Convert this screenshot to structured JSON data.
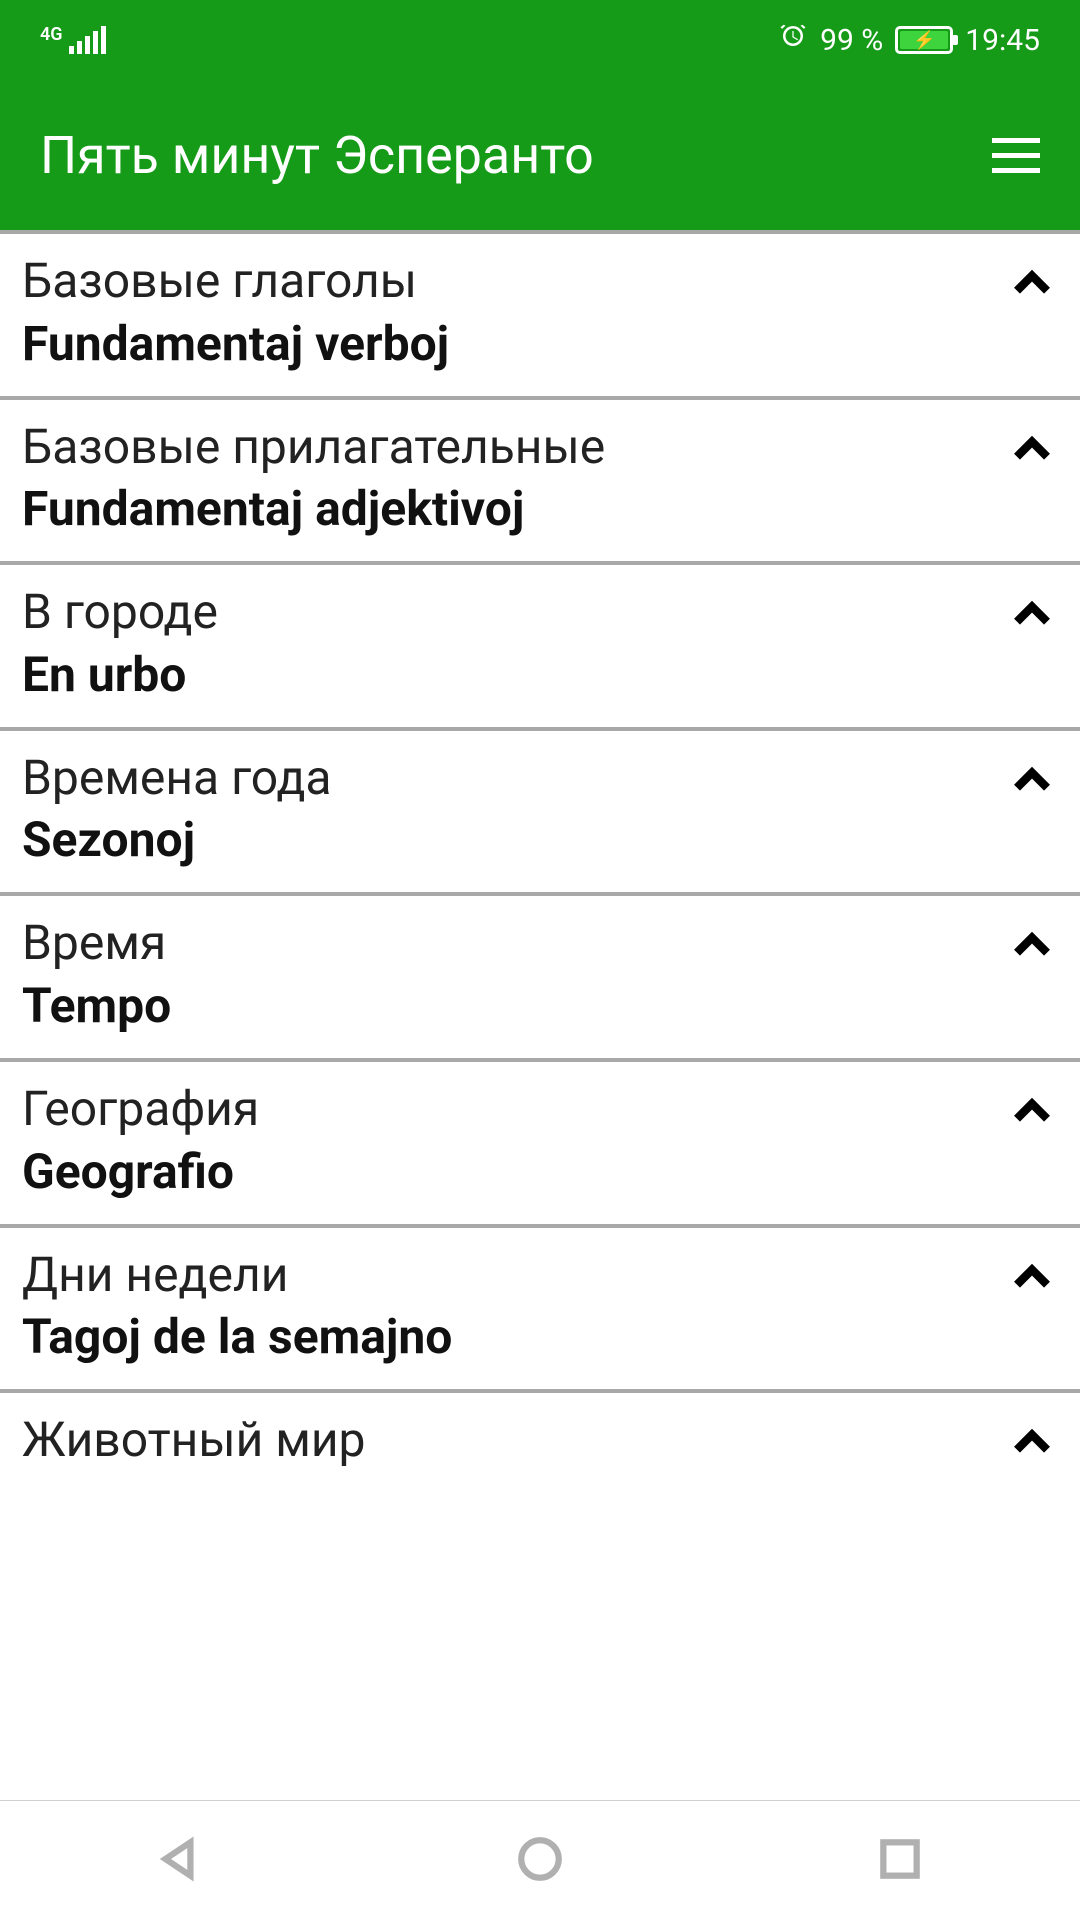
{
  "status": {
    "network": "4G",
    "battery_text": "99 %",
    "time": "19:45"
  },
  "app": {
    "title": "Пять минут Эсперанто"
  },
  "list": [
    {
      "ru": "Базовые глаголы",
      "eo": "Fundamentaj verboj"
    },
    {
      "ru": "Базовые прилагательные",
      "eo": "Fundamentaj adjektivoj"
    },
    {
      "ru": "В городе",
      "eo": "En urbo"
    },
    {
      "ru": "Времена года",
      "eo": "Sezonoj"
    },
    {
      "ru": "Время",
      "eo": "Tempo"
    },
    {
      "ru": "География",
      "eo": "Geografio"
    },
    {
      "ru": "Дни недели",
      "eo": "Tagoj de la semajno"
    },
    {
      "ru": "Животный мир",
      "eo": ""
    }
  ]
}
